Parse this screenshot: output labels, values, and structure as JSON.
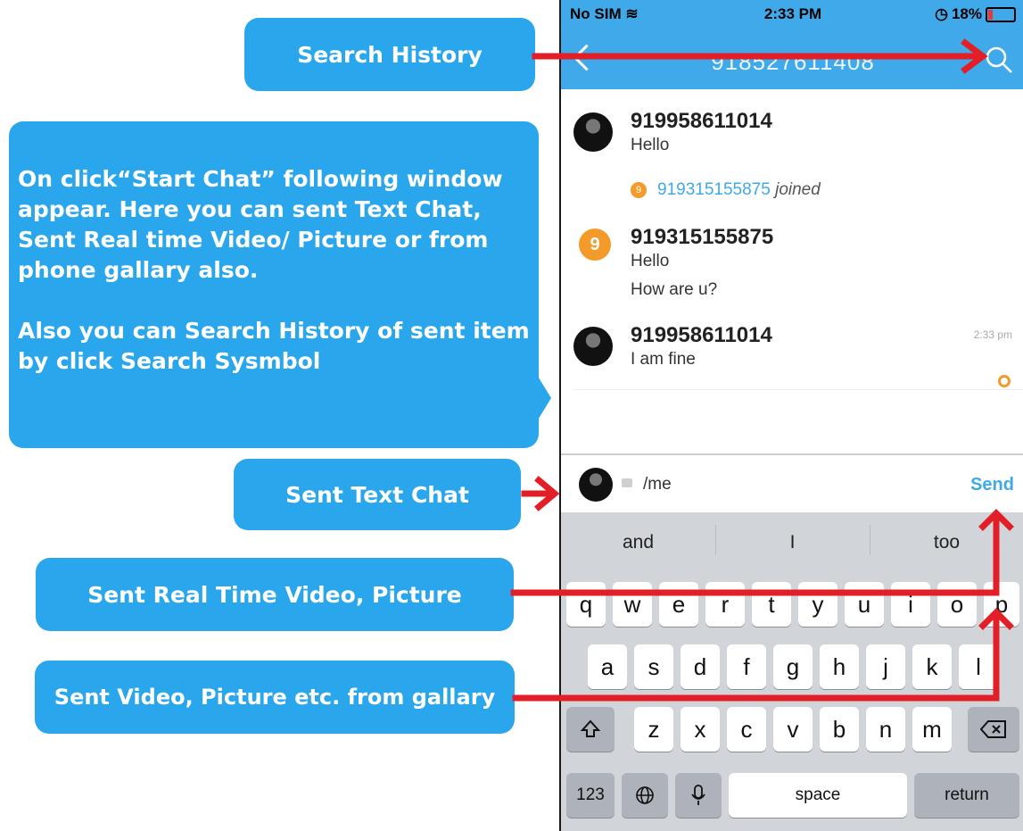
{
  "callouts": {
    "search_history": "Search History",
    "info_p1": "On click“Start Chat” following window appear. Here you can sent Text Chat, Sent Real time Video/ Picture or from phone gallary also.",
    "info_p2": "Also you can Search History of sent item by click Search Sysmbol",
    "sent_text_chat": "Sent Text Chat",
    "sent_real_time": "Sent Real Time Video, Picture",
    "sent_gallery": "Sent Video, Picture etc. from gallary"
  },
  "status_bar": {
    "carrier": "No SIM",
    "time": "2:33 PM",
    "battery": "18%"
  },
  "header": {
    "title": "918527611408"
  },
  "messages": [
    {
      "sender": "919958611014",
      "lines": [
        "Hello"
      ]
    },
    {
      "sender": "919315155875",
      "lines": [
        "Hello",
        "How are u?"
      ]
    },
    {
      "sender": "919958611014",
      "lines": [
        "I am fine"
      ],
      "time": "2:33 pm"
    }
  ],
  "joined_event": {
    "number": "919315155875",
    "text": "joined",
    "avatar_letter": "9"
  },
  "avatar_letter": "9",
  "input": {
    "value": "/me",
    "send_label": "Send"
  },
  "keyboard": {
    "suggestions": [
      "and",
      "I",
      "too"
    ],
    "row1": [
      "q",
      "w",
      "e",
      "r",
      "t",
      "y",
      "u",
      "i",
      "o",
      "p"
    ],
    "row2": [
      "a",
      "s",
      "d",
      "f",
      "g",
      "h",
      "j",
      "k",
      "l"
    ],
    "row3": [
      "z",
      "x",
      "c",
      "v",
      "b",
      "n",
      "m"
    ],
    "numbers_label": "123",
    "space_label": "space",
    "return_label": "return"
  },
  "colors": {
    "accent": "#3fa9e9",
    "callout": "#2aa6ec",
    "arrow": "#e21f26",
    "avatar_orange": "#f39a2a"
  }
}
